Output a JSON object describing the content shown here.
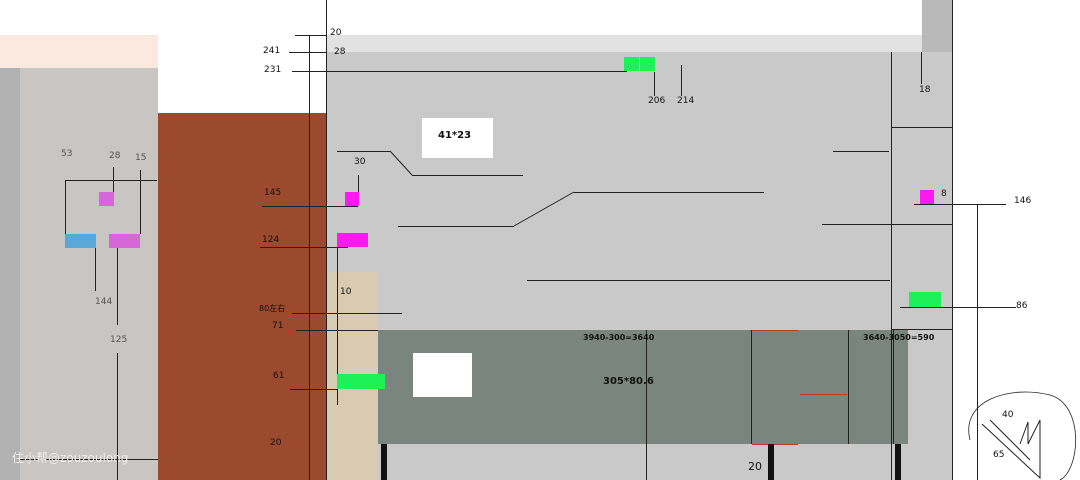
{
  "dimensions": {
    "top_20": "20",
    "d241": "241",
    "d28_top": "28",
    "d231": "231",
    "d206": "206",
    "d214": "214",
    "d18": "18",
    "d53": "53",
    "d28_left": "28",
    "d15": "15",
    "d30": "30",
    "d145": "145",
    "d8": "8",
    "d146": "146",
    "d124": "124",
    "d144": "144",
    "d10": "10",
    "d86": "86",
    "d80": "80左右",
    "d71": "71",
    "d125": "125",
    "d61": "61",
    "d20_bottom_left": "20",
    "d20_bottom_mid": "20",
    "d40": "40",
    "d65": "65"
  },
  "boxes": {
    "small_panel": "41*23",
    "cabinet": "305*80.6",
    "calc_left": "3940-300=3640",
    "calc_right": "3640-3050=590"
  },
  "watermark": "住小帮@zouzoulong",
  "colors": {
    "wall": "#c9c9c9",
    "wood": "#9b4a2f",
    "cabinet": "#7b857f",
    "beige": "#d8cbb2",
    "left_wall": "#c8c5c2",
    "green_outlet": "#1ef05a",
    "magenta_outlet": "#ff19ee"
  }
}
